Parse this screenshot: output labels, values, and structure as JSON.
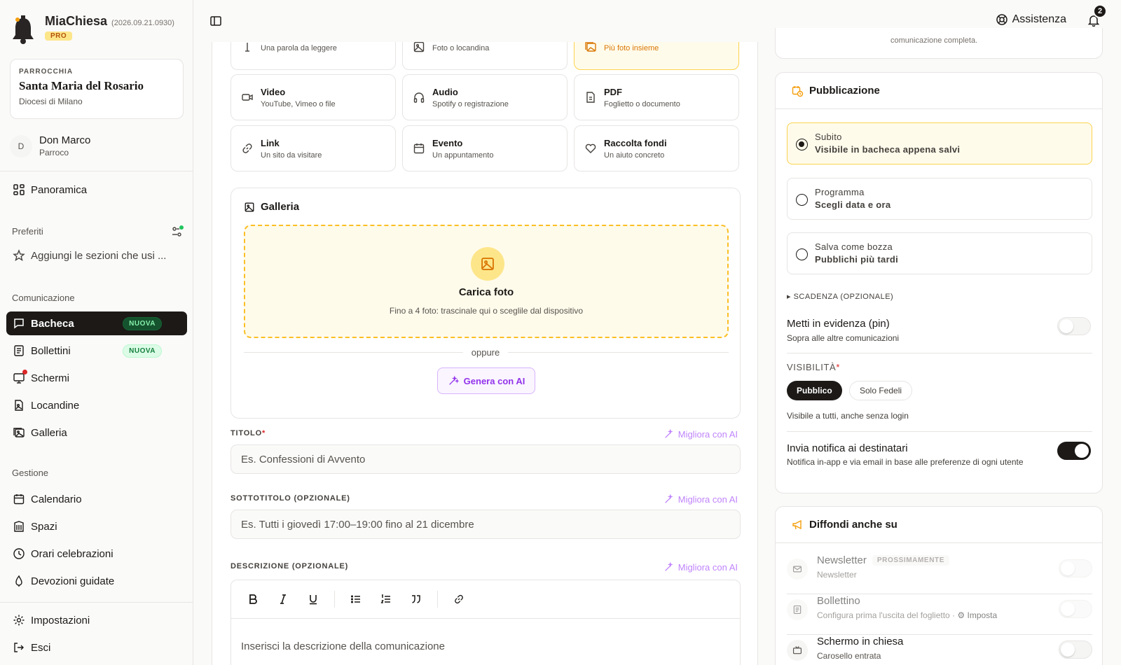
{
  "app": {
    "name": "MiaChiesa",
    "version": "(2026.09.21.0930)",
    "plan": "PRO"
  },
  "parish": {
    "kicker": "PARROCCHIA",
    "name": "Santa Maria del Rosario",
    "diocese": "Diocesi di Milano"
  },
  "user": {
    "initial": "D",
    "name": "Don Marco",
    "role": "Parroco"
  },
  "sidebar": {
    "overview": "Panoramica",
    "favorites_label": "Preferiti",
    "favorites_hint": "Aggiungi le sezioni che usi ...",
    "communication_label": "Comunicazione",
    "communication": [
      {
        "label": "Bacheca",
        "badge": "NUOVA"
      },
      {
        "label": "Bollettini",
        "badge": "NUOVA"
      },
      {
        "label": "Schermi"
      },
      {
        "label": "Locandine"
      },
      {
        "label": "Galleria"
      }
    ],
    "management_label": "Gestione",
    "management": [
      {
        "label": "Calendario"
      },
      {
        "label": "Spazi"
      },
      {
        "label": "Orari celebrazioni"
      },
      {
        "label": "Devozioni guidate"
      }
    ],
    "settings": "Impostazioni",
    "logout": "Esci"
  },
  "topbar": {
    "help": "Assistenza",
    "notifications_count": "2"
  },
  "types": [
    {
      "title": "",
      "sub": "Una parola da leggere"
    },
    {
      "title": "",
      "sub": "Foto o locandina"
    },
    {
      "title": "",
      "sub": "Più foto insieme",
      "selected": true
    },
    {
      "title": "Video",
      "sub": "YouTube, Vimeo o file"
    },
    {
      "title": "Audio",
      "sub": "Spotify o registrazione"
    },
    {
      "title": "PDF",
      "sub": "Foglietto o documento"
    },
    {
      "title": "Link",
      "sub": "Un sito da visitare"
    },
    {
      "title": "Evento",
      "sub": "Un appuntamento"
    },
    {
      "title": "Raccolta fondi",
      "sub": "Un aiuto concreto"
    }
  ],
  "gallery": {
    "title": "Galleria",
    "upload_title": "Carica foto",
    "upload_sub": "Fino a 4 foto: trascinale qui o sceglile dal dispositivo",
    "or": "oppure",
    "ai_button": "Genera con AI"
  },
  "form": {
    "title_label": "TITOLO",
    "title_placeholder": "Es. Confessioni di Avvento",
    "subtitle_label": "SOTTOTITOLO (OPZIONALE)",
    "subtitle_placeholder": "Es. Tutti i giovedì 17:00–19:00 fino al 21 dicembre",
    "description_label": "DESCRIZIONE (OPZIONALE)",
    "description_placeholder": "Inserisci la descrizione della comunicazione",
    "ai_improve": "Migliora con AI",
    "required_mark": "*"
  },
  "right": {
    "top_card_text": "comunicazione completa.",
    "publication_title": "Pubblicazione",
    "options": [
      {
        "title": "Subito",
        "sub": "Visibile in bacheca appena salvi",
        "selected": true
      },
      {
        "title": "Programma",
        "sub": "Scegli data e ora"
      },
      {
        "title": "Salva come bozza",
        "sub": "Pubblichi più tardi"
      }
    ],
    "deadline": "▸ SCADENZA (OPZIONALE)",
    "pin_title": "Metti in evidenza (pin)",
    "pin_sub": "Sopra alle altre comunicazioni",
    "pin_on": false,
    "visibility_label": "VISIBILITÀ",
    "visibility_options": [
      "Pubblico",
      "Solo Fedeli"
    ],
    "visibility_note": "Visibile a tutti, anche senza login",
    "notify_title": "Invia notifica ai destinatari",
    "notify_sub": "Notifica in-app e via email in base alle preferenze di ogni utente",
    "notify_on": true,
    "spread_title": "Diffondi anche su",
    "channels": [
      {
        "title": "Newsletter",
        "badge": "PROSSIMAMENTE",
        "sub": "Newsletter"
      },
      {
        "title": "Bollettino",
        "sub": "Configura prima l'uscita del foglietto · ",
        "action": "Imposta"
      },
      {
        "title": "Schermo in chiesa",
        "sub": "Carosello entrata"
      }
    ]
  },
  "colors": {
    "accent": "#f59e0b",
    "accent_bg": "#fffbeb",
    "dark": "#1c1917",
    "ai": "#9333ea",
    "success": "#22c55e",
    "danger": "#dc2626"
  }
}
